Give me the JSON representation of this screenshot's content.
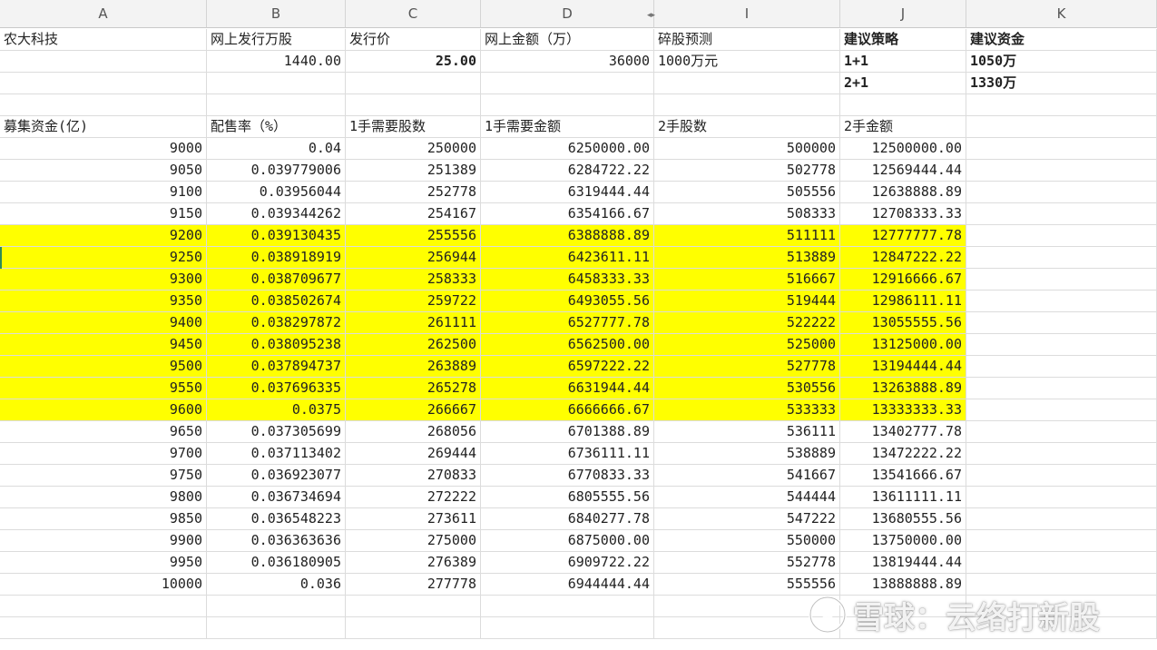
{
  "columns": [
    "A",
    "B",
    "C",
    "D",
    "I",
    "J",
    "K"
  ],
  "summary": {
    "company": "农大科技",
    "online_shares_label": "网上发行万股",
    "online_shares_value": "1440.00",
    "price_label": "发行价",
    "price_value": "25.00",
    "online_amount_label": "网上金额（万）",
    "online_amount_value": "36000",
    "odd_lot_label": "碎股预测",
    "odd_lot_value": "1000万元",
    "strategy_label": "建议策略",
    "funds_label": "建议资金",
    "strategies": [
      {
        "strategy": "1+1",
        "funds": "1050万"
      },
      {
        "strategy": "2+1",
        "funds": "1330万"
      }
    ]
  },
  "table": {
    "headers": [
      "募集资金(亿)",
      "配售率（%）",
      "1手需要股数",
      "1手需要金额",
      "2手股数",
      "2手金额"
    ],
    "rows": [
      {
        "fund": "9000",
        "rate": "0.04",
        "shares1": "250000",
        "amount1": "6250000.00",
        "shares2": "500000",
        "amount2": "12500000.00",
        "highlight": false
      },
      {
        "fund": "9050",
        "rate": "0.039779006",
        "shares1": "251389",
        "amount1": "6284722.22",
        "shares2": "502778",
        "amount2": "12569444.44",
        "highlight": false
      },
      {
        "fund": "9100",
        "rate": "0.03956044",
        "shares1": "252778",
        "amount1": "6319444.44",
        "shares2": "505556",
        "amount2": "12638888.89",
        "highlight": false
      },
      {
        "fund": "9150",
        "rate": "0.039344262",
        "shares1": "254167",
        "amount1": "6354166.67",
        "shares2": "508333",
        "amount2": "12708333.33",
        "highlight": false
      },
      {
        "fund": "9200",
        "rate": "0.039130435",
        "shares1": "255556",
        "amount1": "6388888.89",
        "shares2": "511111",
        "amount2": "12777777.78",
        "highlight": true
      },
      {
        "fund": "9250",
        "rate": "0.038918919",
        "shares1": "256944",
        "amount1": "6423611.11",
        "shares2": "513889",
        "amount2": "12847222.22",
        "highlight": true
      },
      {
        "fund": "9300",
        "rate": "0.038709677",
        "shares1": "258333",
        "amount1": "6458333.33",
        "shares2": "516667",
        "amount2": "12916666.67",
        "highlight": true
      },
      {
        "fund": "9350",
        "rate": "0.038502674",
        "shares1": "259722",
        "amount1": "6493055.56",
        "shares2": "519444",
        "amount2": "12986111.11",
        "highlight": true
      },
      {
        "fund": "9400",
        "rate": "0.038297872",
        "shares1": "261111",
        "amount1": "6527777.78",
        "shares2": "522222",
        "amount2": "13055555.56",
        "highlight": true
      },
      {
        "fund": "9450",
        "rate": "0.038095238",
        "shares1": "262500",
        "amount1": "6562500.00",
        "shares2": "525000",
        "amount2": "13125000.00",
        "highlight": true
      },
      {
        "fund": "9500",
        "rate": "0.037894737",
        "shares1": "263889",
        "amount1": "6597222.22",
        "shares2": "527778",
        "amount2": "13194444.44",
        "highlight": true
      },
      {
        "fund": "9550",
        "rate": "0.037696335",
        "shares1": "265278",
        "amount1": "6631944.44",
        "shares2": "530556",
        "amount2": "13263888.89",
        "highlight": true
      },
      {
        "fund": "9600",
        "rate": "0.0375",
        "shares1": "266667",
        "amount1": "6666666.67",
        "shares2": "533333",
        "amount2": "13333333.33",
        "highlight": true
      },
      {
        "fund": "9650",
        "rate": "0.037305699",
        "shares1": "268056",
        "amount1": "6701388.89",
        "shares2": "536111",
        "amount2": "13402777.78",
        "highlight": false
      },
      {
        "fund": "9700",
        "rate": "0.037113402",
        "shares1": "269444",
        "amount1": "6736111.11",
        "shares2": "538889",
        "amount2": "13472222.22",
        "highlight": false
      },
      {
        "fund": "9750",
        "rate": "0.036923077",
        "shares1": "270833",
        "amount1": "6770833.33",
        "shares2": "541667",
        "amount2": "13541666.67",
        "highlight": false
      },
      {
        "fund": "9800",
        "rate": "0.036734694",
        "shares1": "272222",
        "amount1": "6805555.56",
        "shares2": "544444",
        "amount2": "13611111.11",
        "highlight": false
      },
      {
        "fund": "9850",
        "rate": "0.036548223",
        "shares1": "273611",
        "amount1": "6840277.78",
        "shares2": "547222",
        "amount2": "13680555.56",
        "highlight": false
      },
      {
        "fund": "9900",
        "rate": "0.036363636",
        "shares1": "275000",
        "amount1": "6875000.00",
        "shares2": "550000",
        "amount2": "13750000.00",
        "highlight": false
      },
      {
        "fund": "9950",
        "rate": "0.036180905",
        "shares1": "276389",
        "amount1": "6909722.22",
        "shares2": "552778",
        "amount2": "13819444.44",
        "highlight": false
      },
      {
        "fund": "10000",
        "rate": "0.036",
        "shares1": "277778",
        "amount1": "6944444.44",
        "shares2": "555556",
        "amount2": "13888888.89",
        "highlight": false
      }
    ]
  },
  "colors": {
    "highlight": "#ffff00",
    "header_bg": "#f3f3f3",
    "grid": "#dcdcdc"
  },
  "watermark": {
    "icon": "snowball-logo-icon",
    "text": "雪球：云络打新股"
  }
}
